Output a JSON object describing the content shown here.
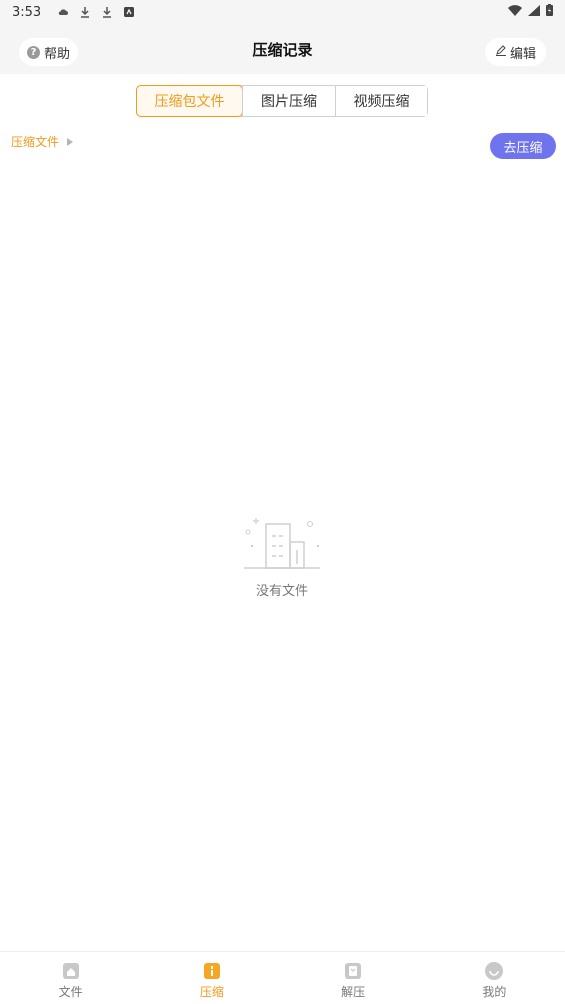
{
  "status_bar": {
    "time": "3:53",
    "icons": [
      "cloud-icon",
      "download-icon",
      "download-icon",
      "app-notification-icon"
    ],
    "right_icons": [
      "wifi-icon",
      "signal-icon",
      "battery-icon"
    ]
  },
  "header": {
    "title": "压缩记录",
    "help_label": "帮助",
    "edit_label": "编辑"
  },
  "tabs": [
    {
      "label": "压缩包文件",
      "active": true
    },
    {
      "label": "图片压缩",
      "active": false
    },
    {
      "label": "视频压缩",
      "active": false
    }
  ],
  "breadcrumb": {
    "label": "压缩文件"
  },
  "action": {
    "go_compress_label": "去压缩"
  },
  "empty_state": {
    "text": "没有文件",
    "icon": "empty-building-icon"
  },
  "bottom_nav": [
    {
      "label": "文件",
      "icon": "home-icon",
      "active": false
    },
    {
      "label": "压缩",
      "icon": "compress-icon",
      "active": true
    },
    {
      "label": "解压",
      "icon": "extract-icon",
      "active": false
    },
    {
      "label": "我的",
      "icon": "profile-icon",
      "active": false
    }
  ],
  "colors": {
    "accent": "#f09a1e",
    "button_purple": "#6f74ee",
    "header_bg": "#f5f5f5"
  }
}
